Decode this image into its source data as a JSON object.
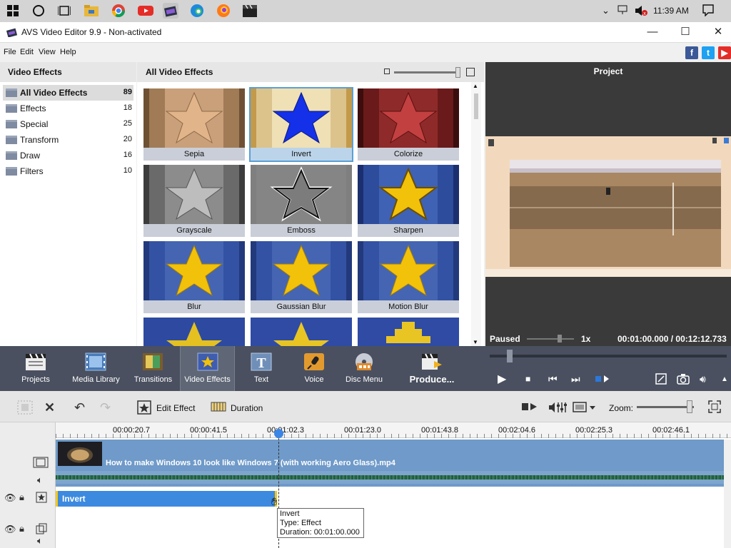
{
  "taskbar": {
    "clock": "11:39 AM",
    "icons": [
      "windows-start-icon",
      "cortana-circle-icon",
      "task-view-icon",
      "file-explorer-icon",
      "chrome-icon",
      "youtube-icon",
      "avs-video-editor-icon",
      "edge-icon",
      "firefox-icon",
      "clapperboard-icon"
    ]
  },
  "window": {
    "title": "AVS Video Editor 9.9 - Non-activated",
    "minimize": "—",
    "maximize": "☐",
    "close": "✕"
  },
  "menu": {
    "file": "File",
    "edit": "Edit",
    "view": "View",
    "help": "Help"
  },
  "social": {
    "facebook": "f",
    "twitter": "t",
    "youtube": "▶"
  },
  "categories": {
    "header": "Video Effects",
    "items": [
      {
        "label": "All Video Effects",
        "count": "89"
      },
      {
        "label": "Effects",
        "count": "18"
      },
      {
        "label": "Special",
        "count": "25"
      },
      {
        "label": "Transform",
        "count": "20"
      },
      {
        "label": "Draw",
        "count": "16"
      },
      {
        "label": "Filters",
        "count": "10"
      }
    ]
  },
  "effects": {
    "header": "All Video Effects",
    "tiles": [
      "Sepia",
      "Invert",
      "Colorize",
      "Grayscale",
      "Emboss",
      "Sharpen",
      "Blur",
      "Gaussian Blur",
      "Motion Blur"
    ]
  },
  "preview": {
    "title": "Project",
    "status": "Paused",
    "speed": "1x",
    "time": "00:01:00.000  /  00:12:12.733"
  },
  "toolbar": {
    "projects": "Projects",
    "media_library": "Media Library",
    "transitions": "Transitions",
    "video_effects": "Video Effects",
    "text": "Text",
    "voice": "Voice",
    "disc_menu": "Disc Menu",
    "produce": "Produce..."
  },
  "timeline_toolbar": {
    "edit_effect": "Edit Effect",
    "duration": "Duration",
    "zoom": "Zoom:"
  },
  "timeline": {
    "ruler": [
      "00:00:20.7",
      "00:00:41.5",
      "00:01:02.3",
      "00:01:23.0",
      "00:01:43.8",
      "00:02:04.6",
      "00:02:25.3",
      "00:02:46.1"
    ],
    "video_clip": "How to make Windows 10 look like Windows 7 (with working Aero Glass).mp4",
    "effect_clip": "Invert",
    "tooltip": {
      "name": "Invert",
      "type": "Type: Effect",
      "duration": "Duration: 00:01:00.000"
    }
  },
  "colors": {
    "toolbar_bg": "#4a5060",
    "selected_blue": "#3c8ae0",
    "track_blue": "#6f9ac9",
    "star_gold": "#f2c10a",
    "star_blue_invert": "#1430e8"
  }
}
